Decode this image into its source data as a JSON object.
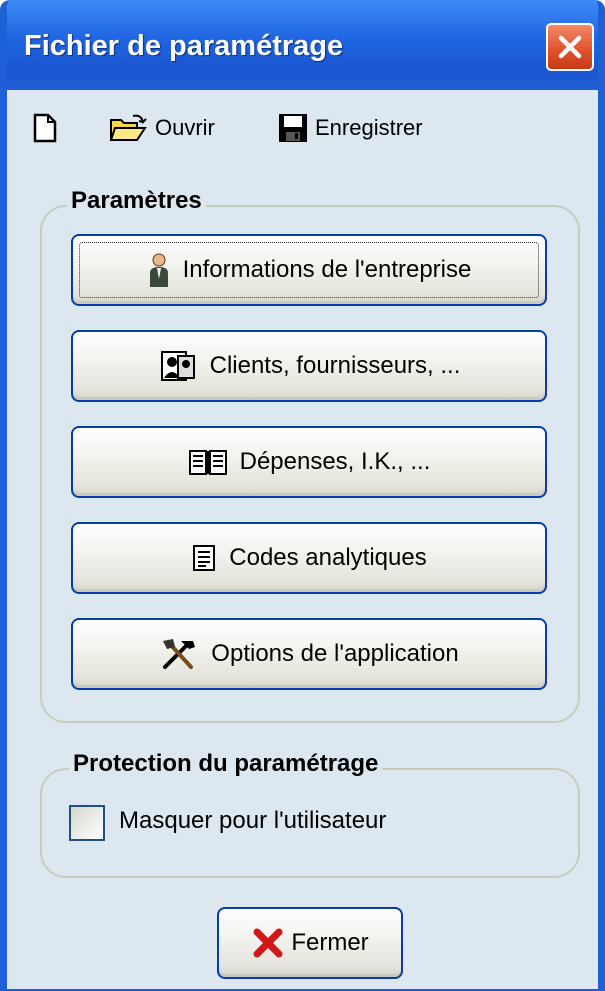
{
  "window": {
    "title": "Fichier de paramétrage"
  },
  "toolbar": {
    "new_icon": "new-document-icon",
    "open_label": "Ouvrir",
    "open_icon": "open-folder-icon",
    "save_label": "Enregistrer",
    "save_icon": "floppy-disk-icon"
  },
  "parametres": {
    "legend": "Paramètres",
    "buttons": [
      {
        "label": "Informations de l'entreprise",
        "icon": "person-icon"
      },
      {
        "label": "Clients, fournisseurs, ...",
        "icon": "contacts-icon"
      },
      {
        "label": "Dépenses, I.K., ...",
        "icon": "book-icon"
      },
      {
        "label": "Codes analytiques",
        "icon": "list-document-icon"
      },
      {
        "label": "Options de l'application",
        "icon": "tools-icon"
      }
    ]
  },
  "protection": {
    "legend": "Protection du paramétrage",
    "checkbox_label": "Masquer pour l'utilisateur",
    "checked": false
  },
  "footer": {
    "close_label": "Fermer",
    "close_icon": "red-x-icon"
  },
  "colors": {
    "titlebar": "#1f5fd6",
    "window_bg": "#dde7f0",
    "button_border": "#0a3ca8",
    "close_red": "#e0502a"
  }
}
